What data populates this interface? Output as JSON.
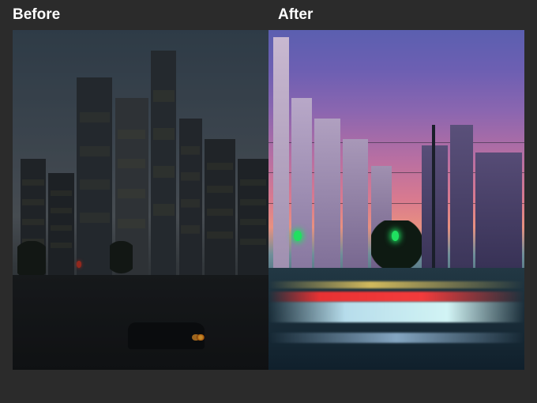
{
  "labels": {
    "before": "Before",
    "after": "After"
  }
}
